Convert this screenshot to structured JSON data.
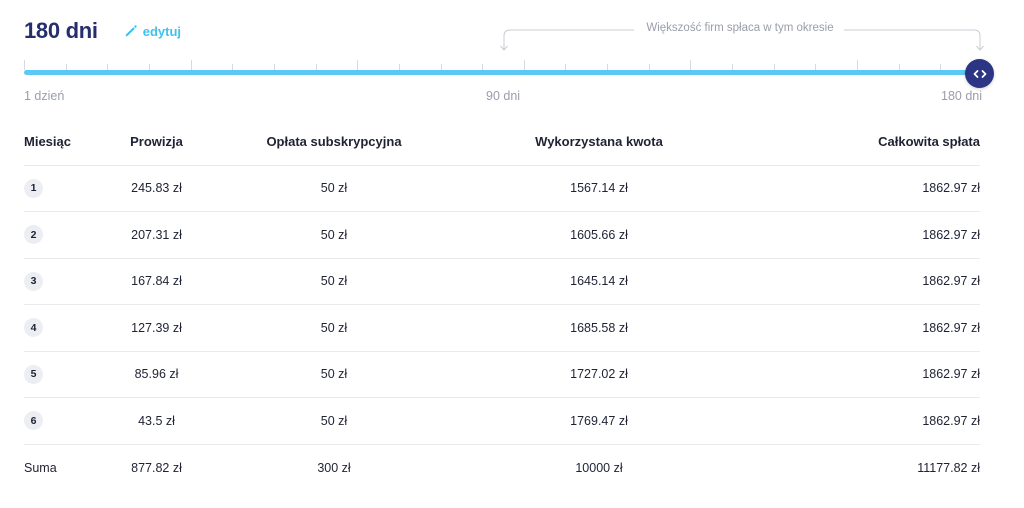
{
  "header": {
    "period_value": "180 dni",
    "edit_label": "edytuj"
  },
  "slider": {
    "bracket_note": "Większość firm spłaca w tym okresie",
    "min_label": "1 dzień",
    "mid_label": "90 dni",
    "max_label": "180 dni",
    "selected_value_days": 180,
    "max_days": 180,
    "accent_color": "#5bc8f5",
    "handle_color": "#2b3583"
  },
  "table": {
    "headers": [
      "Miesiąc",
      "Prowizja",
      "Opłata subskrypcyjna",
      "Wykorzystana kwota",
      "Całkowita spłata"
    ],
    "rows": [
      {
        "month": "1",
        "commission": "245.83 zł",
        "subscription": "50 zł",
        "used": "1567.14 zł",
        "total": "1862.97 zł"
      },
      {
        "month": "2",
        "commission": "207.31 zł",
        "subscription": "50 zł",
        "used": "1605.66 zł",
        "total": "1862.97 zł"
      },
      {
        "month": "3",
        "commission": "167.84 zł",
        "subscription": "50 zł",
        "used": "1645.14 zł",
        "total": "1862.97 zł"
      },
      {
        "month": "4",
        "commission": "127.39 zł",
        "subscription": "50 zł",
        "used": "1685.58 zł",
        "total": "1862.97 zł"
      },
      {
        "month": "5",
        "commission": "85.96 zł",
        "subscription": "50 zł",
        "used": "1727.02 zł",
        "total": "1862.97 zł"
      },
      {
        "month": "6",
        "commission": "43.5 zł",
        "subscription": "50 zł",
        "used": "1769.47 zł",
        "total": "1862.97 zł"
      }
    ],
    "sum": {
      "label": "Suma",
      "commission": "877.82 zł",
      "subscription": "300 zł",
      "used": "10000 zł",
      "total": "11177.82 zł"
    }
  }
}
